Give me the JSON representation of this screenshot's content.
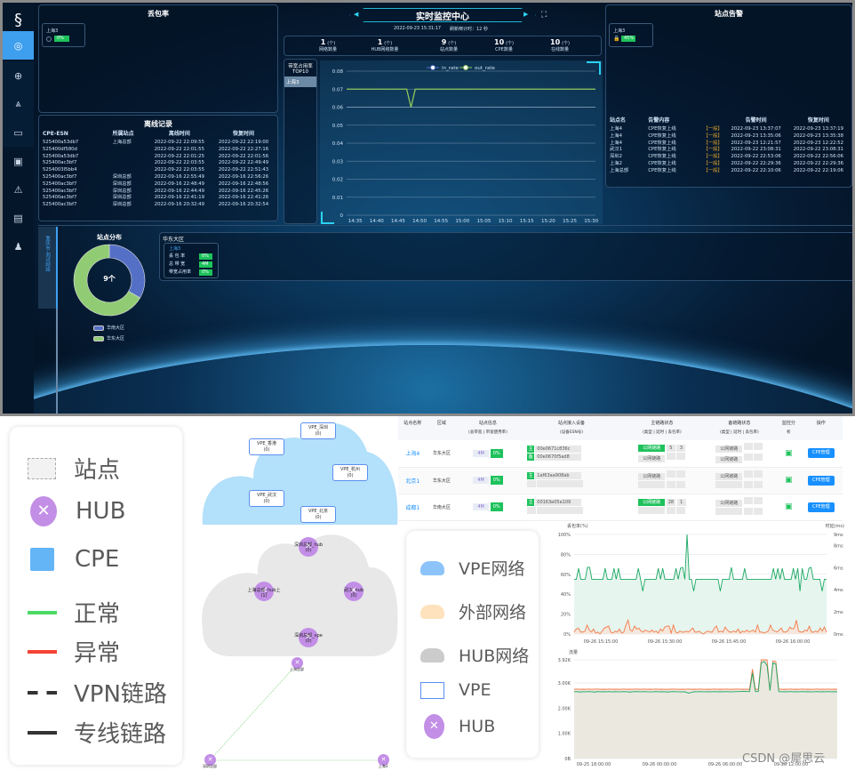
{
  "dashboard": {
    "title": "实时监控中心",
    "datetime": "2022-09-23 15:31:17",
    "refresh_label": "刷新倒计时：12 秒",
    "sidebar": {
      "items": [
        "dashboard-icon",
        "globe-icon",
        "topology-icon",
        "device-icon",
        "layout-icon",
        "alarm-icon",
        "monitor-icon",
        "user-icon"
      ],
      "active": 0
    },
    "stats": [
      {
        "value": "1",
        "unit": "(个)",
        "label": "网络数量"
      },
      {
        "value": "1",
        "unit": "(个)",
        "label": "HUB网络数量"
      },
      {
        "value": "9",
        "unit": "(个)",
        "label": "站点数量"
      },
      {
        "value": "10",
        "unit": "(个)",
        "label": "CPE数量"
      },
      {
        "value": "10",
        "unit": "(个)",
        "label": "在线数量"
      }
    ],
    "loss": {
      "title": "丢包率",
      "site": "上海3",
      "value": "0%"
    },
    "offline": {
      "title": "离线记录",
      "headers": [
        "CPE-ESN",
        "所属站点",
        "离线时间",
        "恢复时间"
      ],
      "rows": [
        [
          "525400a53db7",
          "上海总部",
          "2022-09-22 22:09:55",
          "2022-09-22 22:19:00"
        ],
        [
          "525400df580d",
          "",
          "2022-09-22 22:01:55",
          "2022-09-22 22:27:16"
        ],
        [
          "525400a53db7",
          "",
          "2022-09-22 22:01:25",
          "2022-09-22 22:01:56"
        ],
        [
          "525400ac3bf7",
          "",
          "2022-09-22 22:03:55",
          "2022-09-22 22:49:49"
        ],
        [
          "5254003l5bb4",
          "",
          "2022-09-22 22:03:55",
          "2022-09-22 22:51:43"
        ],
        [
          "525400ac3bf7",
          "深圳总部",
          "2022-09-16 22:55:49",
          "2022-09-16 22:56:26"
        ],
        [
          "525400ac3bf7",
          "深圳总部",
          "2022-09-16 22:48:49",
          "2022-09-16 22:48:56"
        ],
        [
          "525400ac3bf7",
          "深圳总部",
          "2022-09-16 22:44:49",
          "2022-09-16 22:45:26"
        ],
        [
          "525400ac3bf7",
          "深圳总部",
          "2022-09-16 22:41:19",
          "2022-09-16 22:41:26"
        ],
        [
          "525400ac3bf7",
          "深圳总部",
          "2022-09-16 20:32:49",
          "2022-09-16 20:32:54"
        ]
      ]
    },
    "alarm": {
      "title": "站点告警",
      "site": "上海3",
      "badge": "45%",
      "headers": [
        "站点名",
        "告警内容",
        "",
        "告警时间",
        "恢复时间"
      ],
      "rows": [
        [
          "上海4",
          "CPE恢复上线",
          "【一般】",
          "2022-09-23 13:37:07",
          "2022-09-23 13:37:19"
        ],
        [
          "上海4",
          "CPE恢复上线",
          "【一般】",
          "2022-09-23 13:35:06",
          "2022-09-23 13:35:38"
        ],
        [
          "上海4",
          "CPE恢复上线",
          "【一般】",
          "2022-09-23 12:21:57",
          "2022-09-23 12:22:52"
        ],
        [
          "武汉1",
          "CPE恢复上线",
          "【一般】",
          "2022-09-22 23:08:31",
          "2022-09-22 23:08:31"
        ],
        [
          "深圳2",
          "CPE恢复上线",
          "【一般】",
          "2022-09-22 22:53:06",
          "2022-09-22 22:56:06"
        ],
        [
          "上海2",
          "CPE恢复上线",
          "【一般】",
          "2022-09-22 22:29:36",
          "2022-09-22 22:29:36"
        ],
        [
          "上海总部",
          "CPE恢复上线",
          "【一般】",
          "2022-09-22 22:10:06",
          "2022-09-22 22:19:06"
        ]
      ]
    },
    "bw_top": {
      "title_line1": "带宽占用率",
      "title_line2": "TOP10",
      "items": [
        "上海3"
      ]
    },
    "vertical_tab": "重庆市-测试网络",
    "distribution": {
      "title": "站点分布",
      "center": "9个",
      "legend": [
        "华南大区",
        "华东大区"
      ]
    },
    "region": {
      "title": "华东大区",
      "site": "上海3",
      "rows": [
        {
          "label": "丢 包 率",
          "value": "0%"
        },
        {
          "label": "总 带 宽",
          "value": "4M"
        },
        {
          "label": "带宽占用率",
          "value": "0%"
        }
      ]
    }
  },
  "chart_data": [
    {
      "type": "line",
      "legend": [
        "in_rate",
        "out_rate"
      ],
      "ylim": [
        0,
        0.08
      ],
      "yticks": [
        "0",
        "0.01",
        "0.02",
        "0.03",
        "0.04",
        "0.05",
        "0.06",
        "0.07",
        "0.08"
      ],
      "xticks": [
        "14:35",
        "14:40",
        "14:45",
        "14:50",
        "14:55",
        "15:00",
        "15:05",
        "15:10",
        "15:15",
        "15:20",
        "15:25",
        "15:30"
      ],
      "xrange": [
        "14:33",
        "15:31"
      ],
      "series": [
        {
          "name": "out_rate",
          "color": "#8fc75a",
          "points": [
            [
              "14:33",
              0.07
            ],
            [
              "14:47",
              0.07
            ],
            [
              "14:48",
              0.06
            ],
            [
              "14:49",
              0.07
            ],
            [
              "15:31",
              0.07
            ]
          ]
        }
      ],
      "grid": true,
      "legend_position": "top"
    },
    {
      "type": "pie",
      "values": [
        3,
        6
      ],
      "categories": [
        "华南大区",
        "华东大区"
      ],
      "colors": [
        "#5470c6",
        "#91cc75"
      ],
      "total_label": "9个"
    },
    {
      "type": "line",
      "ylabel_left": "丢包率(%)",
      "ylabel_right": "时延(ms)",
      "ylim": [
        0,
        100
      ],
      "yticks_left": [
        "0%",
        "20%",
        "40%",
        "60%",
        "80%",
        "100%"
      ],
      "yticks_right": [
        "0ms",
        "2ms",
        "4ms",
        "6ms",
        "8ms",
        "9ms"
      ],
      "xticks": [
        "09-26 15:15:00",
        "09-26 15:30:00",
        "09-26 15:45:00",
        "09-26 16:00:00"
      ],
      "series": [
        {
          "color": "#1aa862",
          "values": [
            55,
            55,
            66,
            55,
            55,
            55,
            67,
            67,
            55,
            55,
            55,
            55,
            55,
            55,
            66,
            55,
            55,
            55,
            66,
            55,
            66,
            55,
            55,
            55,
            55,
            55,
            55,
            55,
            55,
            66,
            55,
            43,
            55,
            55,
            55,
            55,
            55,
            55,
            66,
            55,
            66,
            55,
            55,
            55,
            55,
            55,
            66,
            55,
            66,
            67,
            55,
            100,
            55,
            55,
            43,
            55,
            55,
            55,
            55,
            55,
            55,
            55,
            55,
            55,
            55,
            55,
            43,
            55,
            55,
            55,
            55,
            67,
            55,
            55,
            55,
            55,
            55,
            66,
            55,
            55,
            55,
            55,
            55,
            55,
            55,
            55,
            55,
            55,
            55,
            55,
            66,
            55,
            66,
            55,
            66,
            55,
            55,
            55,
            55,
            66,
            55,
            66,
            43,
            66,
            55,
            55,
            66,
            67,
            55,
            55,
            55,
            55,
            43,
            55,
            55
          ]
        },
        {
          "color": "#f47a4a",
          "values": [
            2,
            5,
            6,
            2,
            2,
            3,
            9,
            4,
            2,
            5,
            1,
            2,
            0,
            3,
            6,
            7,
            8,
            2,
            1,
            3,
            2,
            5,
            1,
            2,
            9,
            14,
            4,
            3,
            8,
            5,
            6,
            3,
            2,
            4,
            3,
            2,
            4,
            2,
            3,
            1,
            5,
            3,
            7,
            8,
            8,
            1,
            9,
            2,
            1,
            3,
            2,
            2,
            3,
            2,
            4,
            6,
            2,
            2,
            3,
            1,
            0,
            2,
            3,
            2,
            2,
            6,
            8,
            2,
            3,
            2,
            7,
            4,
            2,
            2,
            3,
            2,
            5,
            1,
            3,
            2,
            4,
            2,
            3,
            4,
            2,
            9,
            2,
            2,
            1,
            2,
            3,
            9,
            4,
            3,
            2,
            4,
            6,
            2,
            2,
            3,
            7,
            5,
            6,
            14,
            3,
            2,
            2,
            4,
            3,
            8,
            2,
            2,
            3,
            2,
            6,
            3,
            7,
            2
          ]
        }
      ]
    },
    {
      "type": "line",
      "ylabel": "流量",
      "ylim": [
        0,
        3920
      ],
      "yticks": [
        "0B",
        "1.00K",
        "2.00K",
        "3.00K",
        "3.92K"
      ],
      "xticks": [
        "09-25 18:00:00",
        "09-26 00:00:00",
        "09-26 06:00:00",
        "09-26 12:00:00"
      ],
      "series": [
        {
          "color": "#f47a4a",
          "values": [
            2750,
            2760,
            2750,
            2755,
            2750,
            2760,
            2750,
            2755,
            2760,
            2750,
            2755,
            2750,
            2760,
            2750,
            2755,
            2750,
            2750,
            2760,
            2750,
            2755,
            2750,
            2760,
            2755,
            2750,
            2760,
            2750,
            2755,
            2750,
            2760,
            2750,
            2755,
            2750,
            2750,
            2755,
            2760,
            2750,
            2750,
            2755,
            2750,
            2760,
            2750,
            2755,
            2750,
            2760,
            2750,
            2750,
            2755,
            2750,
            2760,
            2750,
            2755,
            2750,
            2760,
            2750,
            2750,
            2755,
            2760,
            2750,
            2755,
            2750,
            2750,
            3550,
            2750,
            2750,
            3920,
            3920,
            3920,
            2700,
            3880,
            3850,
            2760,
            2750,
            2755,
            2750,
            2760,
            2750,
            2755,
            2750,
            2760,
            2750,
            2755,
            2750,
            2750,
            2760,
            2750,
            2755,
            2750,
            2760,
            2750,
            2755,
            2750
          ]
        },
        {
          "color": "#1aa862",
          "values": [
            2650,
            2660,
            2640,
            2655,
            2650,
            2660,
            2650,
            2640,
            2660,
            2650,
            2655,
            2650,
            2660,
            2645,
            2655,
            2650,
            2650,
            2660,
            2650,
            2640,
            2650,
            2660,
            2655,
            2650,
            2660,
            2650,
            2645,
            2650,
            2660,
            2650,
            2655,
            2650,
            2640,
            2655,
            2660,
            2650,
            2650,
            2645,
            2650,
            2600,
            2620,
            2655,
            2650,
            2660,
            2650,
            2650,
            2655,
            2650,
            2660,
            2650,
            2655,
            2650,
            2660,
            2650,
            2650,
            2655,
            2660,
            2660,
            2670,
            2660,
            2660,
            3400,
            2660,
            2660,
            3800,
            3850,
            3700,
            2700,
            3800,
            3750,
            2660,
            2650,
            2655,
            2650,
            2660,
            2650,
            2655,
            2650,
            2660,
            2650,
            2655,
            2650,
            2650,
            2660,
            2650,
            2655,
            2650,
            2660,
            2650,
            2655,
            2650
          ]
        }
      ]
    }
  ],
  "legend1": [
    {
      "icon": "site-icon",
      "label": "站点"
    },
    {
      "icon": "hub-icon",
      "label": "HUB"
    },
    {
      "icon": "cpe-icon",
      "label": "CPE"
    },
    {
      "icon": "normal-line-icon",
      "label": "正常",
      "color": "#4cd964"
    },
    {
      "icon": "abnormal-line-icon",
      "label": "异常",
      "color": "#f44336"
    },
    {
      "icon": "vpn-line-icon",
      "label": "VPN链路"
    },
    {
      "icon": "dedicated-line-icon",
      "label": "专线链路"
    }
  ],
  "legend2": [
    {
      "icon": "cloud-icon",
      "label": "VPE网络",
      "color": "#8cc4fa"
    },
    {
      "icon": "cloud-icon",
      "label": "外部网络",
      "color": "#fde2bd"
    },
    {
      "icon": "cloud-icon",
      "label": "HUB网络",
      "color": "#cccccc"
    },
    {
      "icon": "vpe-box-icon",
      "label": "VPE"
    },
    {
      "icon": "hub-icon",
      "label": "HUB"
    }
  ],
  "topology": {
    "vpes": [
      {
        "name": "VPE_深圳",
        "count": "(0)"
      },
      {
        "name": "VPE_香港",
        "count": "(0)"
      },
      {
        "name": "VPE_杭州",
        "count": "(0)"
      },
      {
        "name": "VPE_武汉",
        "count": "(0)"
      },
      {
        "name": "VPE_北京",
        "count": "(0)"
      }
    ],
    "hubs": [
      {
        "name": "深圳总部_hub",
        "count": "(0)"
      },
      {
        "name": "上海总部_hub上",
        "count": "(1)"
      },
      {
        "name": "武汉_hub",
        "count": "(0)"
      },
      {
        "name": "深圳总部_vpe",
        "count": "(0)"
      }
    ],
    "sites": [
      "上海总部",
      "深圳总部",
      "上海3"
    ]
  },
  "site_table": {
    "headers": [
      {
        "t": "站点名称",
        "s": ""
      },
      {
        "t": "区域",
        "s": ""
      },
      {
        "t": "站点信息",
        "s": "(总带宽 | 带宽使用率)"
      },
      {
        "t": "站点接入设备",
        "s": "(设备ESN号)"
      },
      {
        "t": "主链路状态",
        "s": "(类型 | 延时 | 丢包率)"
      },
      {
        "t": "备链路状态",
        "s": "(类型 | 延时 | 丢包率)"
      },
      {
        "t": "监控分",
        "s": "析"
      },
      {
        "t": "操作",
        "s": ""
      }
    ],
    "rows": [
      {
        "name": "上海4",
        "region": "华东大区",
        "bw": "4M",
        "usage": "0%",
        "dev": [
          [
            "主",
            "00e0671c836c"
          ],
          [
            "备",
            "00e0670f5ad8"
          ]
        ],
        "main": [
          [
            "公网链路",
            "5",
            "3",
            true
          ],
          [
            "公网链路",
            "",
            "",
            false
          ]
        ],
        "backup": [
          [
            "公网链路",
            "",
            ""
          ],
          [
            "公网链路",
            "",
            ""
          ]
        ],
        "op": "CPE管理"
      },
      {
        "name": "北京1",
        "region": "华东大区",
        "bw": "4M",
        "usage": "0%",
        "dev": [
          [
            "主",
            "1af63aa908ab"
          ],
          [
            "",
            ""
          ]
        ],
        "main": [
          [
            "公网链路",
            "",
            "",
            false
          ],
          [
            "",
            "",
            "",
            false
          ]
        ],
        "backup": [
          [
            "公网链路",
            "",
            ""
          ],
          [
            "",
            "",
            ""
          ]
        ],
        "op": "CPE管理"
      },
      {
        "name": "成都1",
        "region": "华南大区",
        "bw": "4M",
        "usage": "0%",
        "dev": [
          [
            "主",
            "00163e05e109"
          ],
          [
            "",
            ""
          ]
        ],
        "main": [
          [
            "公网链路",
            "28",
            "1",
            true
          ],
          [
            "",
            "",
            "",
            false
          ]
        ],
        "backup": [
          [
            "公网链路",
            "",
            ""
          ],
          [
            "",
            "",
            ""
          ]
        ],
        "op": "CPE管理"
      }
    ]
  },
  "watermark": "CSDN @犀思云"
}
